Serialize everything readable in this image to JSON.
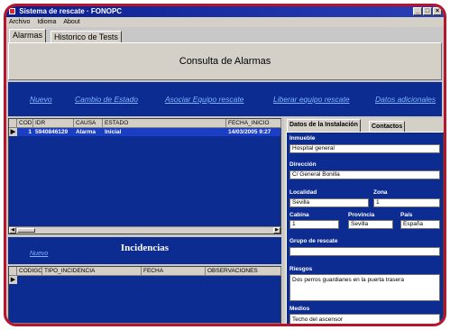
{
  "window": {
    "title": "Sistema de rescate · FONOPC"
  },
  "menu": [
    "Archivo",
    "Idioma",
    "About"
  ],
  "tabs": [
    {
      "label": "Alarmas",
      "active": true
    },
    {
      "label": "Historico de Tests",
      "active": false
    }
  ],
  "header": {
    "title": "Consulta de Alarmas"
  },
  "actions": [
    "Nuevo",
    "Cambio de Estado",
    "Asociar Equipo rescate",
    "Liberar equipo rescate",
    "Datos adicionales"
  ],
  "alarms_grid": {
    "columns": [
      "COD",
      "IDR",
      "CAUSA",
      "ESTADO",
      "FECHA_INICIO"
    ],
    "rows": [
      {
        "cod": "1",
        "idr": "5940846129",
        "causa": "Alarma",
        "estado": "Inicial",
        "fecha": "14/03/2005 9:27"
      }
    ]
  },
  "incidencias": {
    "title": "Incidencias",
    "new_link": "Nuevo",
    "columns": [
      "CODIGO",
      "TIPO_INCIDENCIA",
      "FECHA",
      "OBSERVACIONES"
    ]
  },
  "details": {
    "tabs": [
      "Datos de la Instalación",
      "Contactos"
    ],
    "fields": {
      "inmueble": {
        "label": "Inmueble",
        "value": "Hospital general"
      },
      "direccion": {
        "label": "Dirección",
        "value": "C/ General Bonilla"
      },
      "localidad": {
        "label": "Localidad",
        "value": "Sevilla"
      },
      "zona": {
        "label": "Zona",
        "value": "1"
      },
      "cabina": {
        "label": "Cabina",
        "value": "1"
      },
      "provincia": {
        "label": "Provincia",
        "value": "Sevilla"
      },
      "pais": {
        "label": "País",
        "value": "España"
      },
      "grupo": {
        "label": "Grupo de rescate",
        "value": ""
      },
      "riesgos": {
        "label": "Riesgos",
        "value": "Dos perros guardianes en la puerta trasera"
      },
      "medios": {
        "label": "Medios",
        "value": "Techo del ascensor"
      }
    }
  },
  "colors": {
    "brand_blue": "#0d2c91",
    "link": "#7fb4ff",
    "frame": "#b8142a",
    "selection": "#1b3fc4"
  },
  "icons": [
    "app-icon",
    "minimize-icon",
    "maximize-icon",
    "close-icon",
    "row-pointer-icon",
    "scroll-left-icon",
    "scroll-right-icon"
  ]
}
